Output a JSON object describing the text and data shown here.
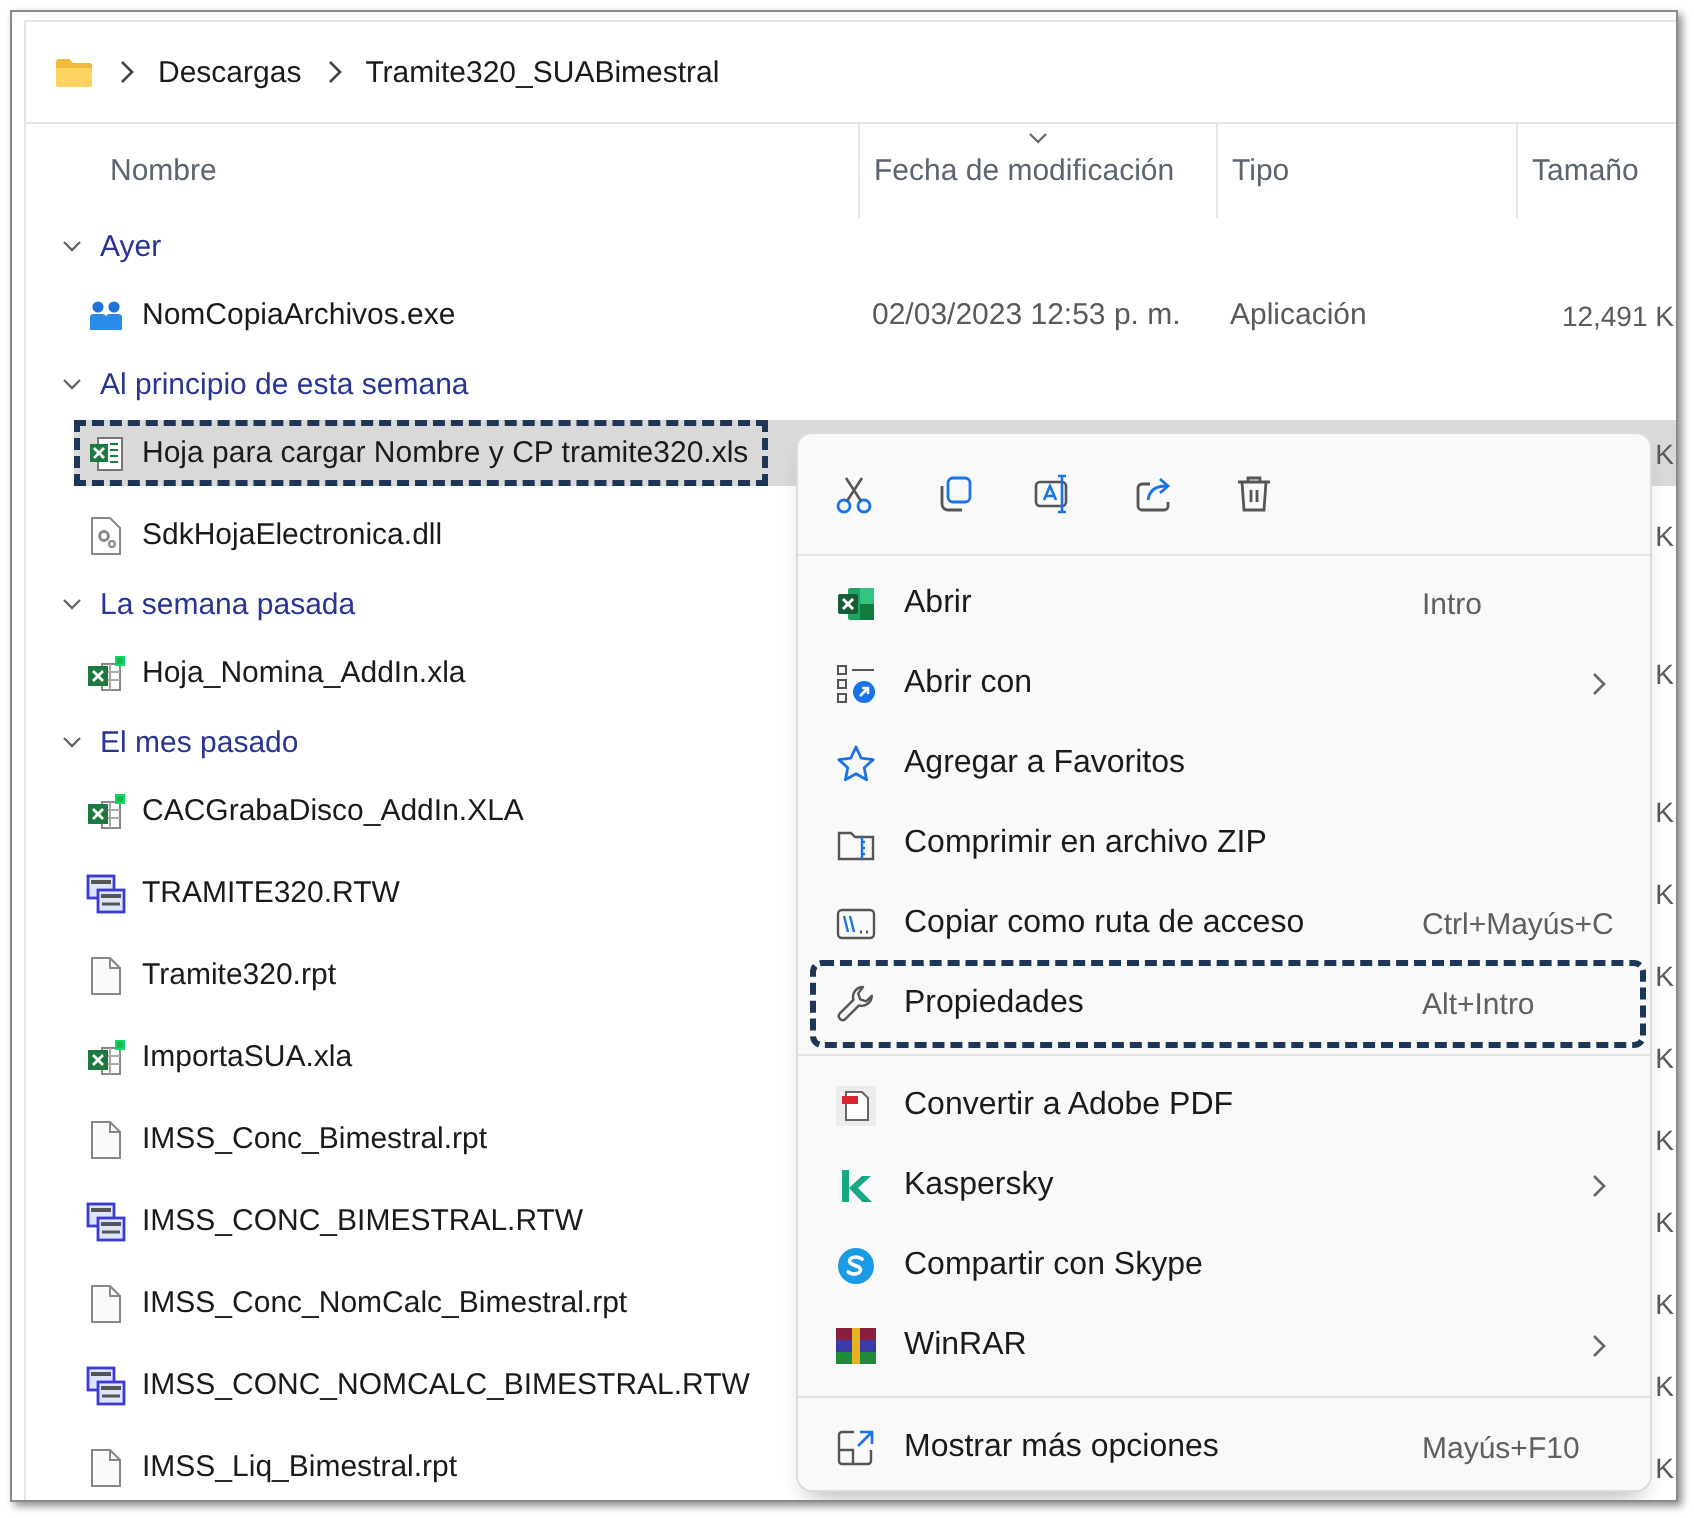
{
  "address_bar": {
    "breadcrumbs": [
      "Descargas",
      "Tramite320_SUABimestral"
    ]
  },
  "columns": [
    {
      "label": "Nombre",
      "sorted": false
    },
    {
      "label": "Fecha de modificación",
      "sorted": true
    },
    {
      "label": "Tipo",
      "sorted": false
    },
    {
      "label": "Tamaño",
      "sorted": false
    }
  ],
  "groups": [
    {
      "label": "Ayer",
      "expanded": true,
      "files": [
        {
          "name": "NomCopiaArchivos.exe",
          "kind": "app",
          "date": "02/03/2023 12:53 p. m.",
          "type": "Aplicación",
          "size": "12,491 K",
          "selected": false,
          "focused": false
        }
      ]
    },
    {
      "label": "Al principio de esta semana",
      "expanded": true,
      "files": [
        {
          "name": "Hoja para cargar Nombre y CP tramite320.xls",
          "kind": "spreadsheet",
          "size": "K",
          "selected": true,
          "focused": true
        },
        {
          "name": "SdkHojaElectronica.dll",
          "kind": "library",
          "size": "K",
          "selected": false,
          "focused": false
        }
      ]
    },
    {
      "label": "La semana pasada",
      "expanded": true,
      "files": [
        {
          "name": "Hoja_Nomina_AddIn.xla",
          "kind": "addin",
          "size": "K",
          "selected": false,
          "focused": false
        }
      ]
    },
    {
      "label": "El mes pasado",
      "expanded": true,
      "files": [
        {
          "name": "CACGrabaDisco_AddIn.XLA",
          "kind": "addin",
          "size": "K",
          "selected": false,
          "focused": false
        },
        {
          "name": "TRAMITE320.RTW",
          "kind": "workspace",
          "size": "K",
          "selected": false,
          "focused": false
        },
        {
          "name": "Tramite320.rpt",
          "kind": "document",
          "size": "K",
          "selected": false,
          "focused": false
        },
        {
          "name": "ImportaSUA.xla",
          "kind": "addin",
          "size": "K",
          "selected": false,
          "focused": false
        },
        {
          "name": "IMSS_Conc_Bimestral.rpt",
          "kind": "document",
          "size": "K",
          "selected": false,
          "focused": false
        },
        {
          "name": "IMSS_CONC_BIMESTRAL.RTW",
          "kind": "workspace",
          "size": "K",
          "selected": false,
          "focused": false
        },
        {
          "name": "IMSS_Conc_NomCalc_Bimestral.rpt",
          "kind": "document",
          "size": "K",
          "selected": false,
          "focused": false
        },
        {
          "name": "IMSS_CONC_NOMCALC_BIMESTRAL.RTW",
          "kind": "workspace",
          "size": "K",
          "selected": false,
          "focused": false
        },
        {
          "name": "IMSS_Liq_Bimestral.rpt",
          "kind": "document",
          "size": "K",
          "selected": false,
          "focused": false
        }
      ]
    }
  ],
  "context_menu": {
    "sections": [
      [
        {
          "label": "Abrir",
          "kind": "excel",
          "shortcut": "Intro",
          "submenu": false,
          "highlighted": false
        },
        {
          "label": "Abrir con",
          "kind": "open-with",
          "submenu": true,
          "highlighted": false
        },
        {
          "label": "Agregar a Favoritos",
          "kind": "star",
          "submenu": false,
          "highlighted": false
        },
        {
          "label": "Comprimir en archivo ZIP",
          "kind": "zip",
          "submenu": false,
          "highlighted": false
        },
        {
          "label": "Copiar como ruta de acceso",
          "kind": "path",
          "shortcut": "Ctrl+Mayús+C",
          "submenu": false,
          "highlighted": false
        },
        {
          "label": "Propiedades",
          "kind": "wrench",
          "shortcut": "Alt+Intro",
          "submenu": false,
          "highlighted": true
        }
      ],
      [
        {
          "label": "Convertir a Adobe PDF",
          "kind": "pdf",
          "submenu": false,
          "highlighted": false
        },
        {
          "label": "Kaspersky",
          "kind": "kaspersky",
          "submenu": true,
          "highlighted": false
        },
        {
          "label": "Compartir con Skype",
          "kind": "skype",
          "submenu": false,
          "highlighted": false
        },
        {
          "label": "WinRAR",
          "kind": "winrar",
          "submenu": true,
          "highlighted": false
        }
      ],
      [
        {
          "label": "Mostrar más opciones",
          "kind": "more",
          "shortcut": "Mayús+F10",
          "submenu": false,
          "highlighted": false
        }
      ]
    ]
  }
}
